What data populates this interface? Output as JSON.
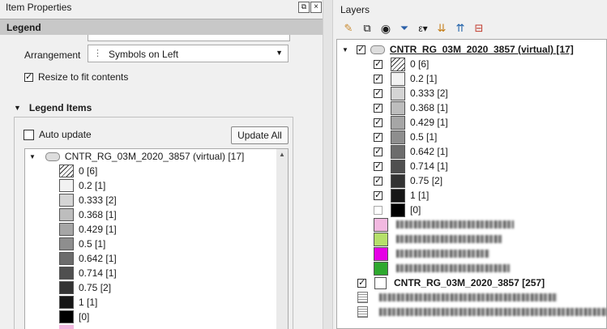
{
  "left": {
    "title": "Item Properties",
    "legend_header": "Legend",
    "arrangement_label": "Arrangement",
    "arrangement_value": "Symbols on Left",
    "resize_label": "Resize to fit contents",
    "legend_items_header": "Legend Items",
    "auto_update_label": "Auto update",
    "update_all_label": "Update All",
    "layer_name": "CNTR_RG_03M_2020_3857 (virtual) [17]",
    "items": [
      {
        "label": "0 [6]",
        "color": "hatch"
      },
      {
        "label": "0.2 [1]",
        "color": "#f2f2f2"
      },
      {
        "label": "0.333 [2]",
        "color": "#d4d4d4"
      },
      {
        "label": "0.368 [1]",
        "color": "#bdbdbd"
      },
      {
        "label": "0.429 [1]",
        "color": "#a6a6a6"
      },
      {
        "label": "0.5 [1]",
        "color": "#8e8e8e"
      },
      {
        "label": "0.642 [1]",
        "color": "#6c6c6c"
      },
      {
        "label": "0.714 [1]",
        "color": "#4f4f4f"
      },
      {
        "label": "0.75 [2]",
        "color": "#333333"
      },
      {
        "label": "1 [1]",
        "color": "#161616"
      },
      {
        "label": " [0]",
        "color": "#000000"
      }
    ]
  },
  "right": {
    "title": "Layers",
    "layer1_name": "CNTR_RG_03M_2020_3857 (virtual) [17]",
    "items": [
      {
        "label": "0 [6]",
        "color": "hatch",
        "checked": true
      },
      {
        "label": "0.2 [1]",
        "color": "#f2f2f2",
        "checked": true
      },
      {
        "label": "0.333 [2]",
        "color": "#d4d4d4",
        "checked": true
      },
      {
        "label": "0.368 [1]",
        "color": "#bdbdbd",
        "checked": true
      },
      {
        "label": "0.429 [1]",
        "color": "#a6a6a6",
        "checked": true
      },
      {
        "label": "0.5 [1]",
        "color": "#8e8e8e",
        "checked": true
      },
      {
        "label": "0.642 [1]",
        "color": "#6c6c6c",
        "checked": true
      },
      {
        "label": "0.714 [1]",
        "color": "#4f4f4f",
        "checked": true
      },
      {
        "label": "0.75 [2]",
        "color": "#333333",
        "checked": true
      },
      {
        "label": "1 [1]",
        "color": "#161616",
        "checked": true
      },
      {
        "label": " [0]",
        "color": "#000000",
        "checked": false
      }
    ],
    "blurred_swatches": [
      "#f2b8e0",
      "#b5e06a",
      "#e600e6",
      "#2ea82e"
    ],
    "layer2_name": "CNTR_RG_03M_2020_3857 [257]"
  }
}
